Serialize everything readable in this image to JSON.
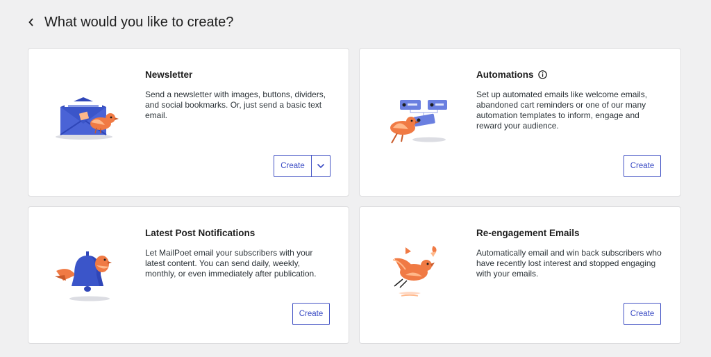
{
  "header": {
    "title": "What would you like to create?"
  },
  "colors": {
    "accent": "#3a4bc4",
    "bird": "#f07a44",
    "envelope": "#3b55c9"
  },
  "cards": [
    {
      "title": "Newsletter",
      "description": "Send a newsletter with images, buttons, dividers, and social bookmarks. Or, just send a basic text email.",
      "button": "Create"
    },
    {
      "title": "Automations",
      "description": "Set up automated emails like welcome emails, abandoned cart reminders or one of our many automation templates to inform, engage and reward your audience.",
      "button": "Create"
    },
    {
      "title": "Latest Post Notifications",
      "description": "Let MailPoet email your subscribers with your latest content. You can send daily, weekly, monthly, or even immediately after publication.",
      "button": "Create"
    },
    {
      "title": "Re-engagement Emails",
      "description": "Automatically email and win back subscribers who have recently lost interest and stopped engaging with your emails.",
      "button": "Create"
    }
  ]
}
